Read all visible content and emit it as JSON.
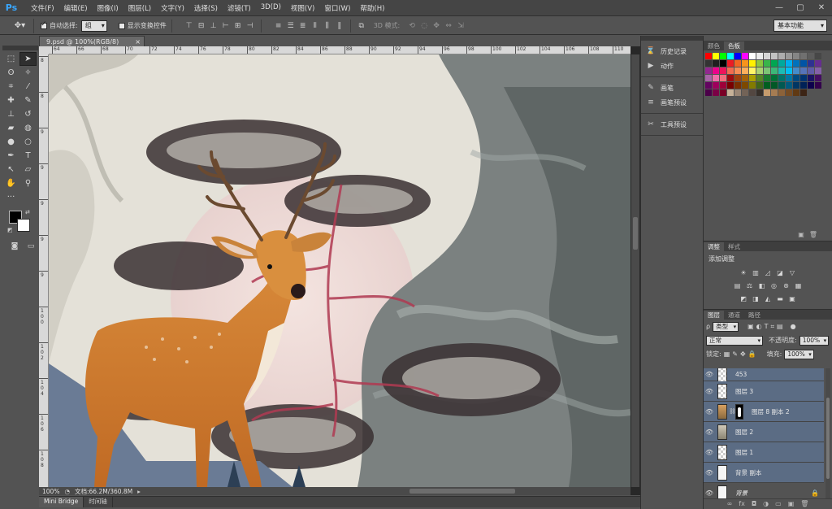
{
  "app": {
    "logo": "Ps",
    "menu": [
      "文件(F)",
      "编辑(E)",
      "图像(I)",
      "图层(L)",
      "文字(Y)",
      "选择(S)",
      "滤镜(T)",
      "3D(D)",
      "视图(V)",
      "窗口(W)",
      "帮助(H)"
    ],
    "window_controls": [
      "—",
      "▢",
      "✕"
    ]
  },
  "options": {
    "auto_select_label": "自动选择:",
    "auto_select_value": "组",
    "show_transform_label": "显示变换控件",
    "mode_3d_label": "3D 模式:",
    "workspace": "基本功能"
  },
  "document": {
    "tab_title": "9.psd @ 100%(RGB/8)",
    "close": "×",
    "zoom": "100%",
    "doc_info": "文档:66.2M/360.8M",
    "ruler_h_labels": [
      "64",
      "66",
      "68",
      "70",
      "72",
      "74",
      "76",
      "78",
      "80",
      "82",
      "84",
      "86",
      "88",
      "90",
      "92",
      "94",
      "96",
      "98",
      "100",
      "102",
      "104",
      "106",
      "108",
      "110"
    ],
    "ruler_v_labels": [
      "8",
      "8",
      "9",
      "9",
      "9",
      "9",
      "9",
      "1 0 0",
      "1 0 2",
      "1 0 4",
      "1 0 6",
      "1 0 8"
    ]
  },
  "bottom_tabs": [
    "Mini Bridge",
    "时间轴"
  ],
  "mid_panel": {
    "groups": [
      [
        {
          "icon": "history-icon",
          "glyph": "⌛",
          "label": "历史记录"
        },
        {
          "icon": "actions-icon",
          "glyph": "▶",
          "label": "动作"
        }
      ],
      [
        {
          "icon": "brush-icon",
          "glyph": "✎",
          "label": "画笔"
        },
        {
          "icon": "brush-presets-icon",
          "glyph": "≡",
          "label": "画笔预设"
        }
      ],
      [
        {
          "icon": "tool-presets-icon",
          "glyph": "✂",
          "label": "工具预设"
        }
      ]
    ]
  },
  "swatches_panel": {
    "tabs": [
      "颜色",
      "色板"
    ],
    "active_tab": 1,
    "colors": [
      "#ff0000",
      "#ffff00",
      "#00ff00",
      "#00ffff",
      "#0000ff",
      "#ff00ff",
      "#ffffff",
      "#ebebeb",
      "#d6d6d6",
      "#c2c2c2",
      "#adadad",
      "#999999",
      "#858585",
      "#707070",
      "#5c5c5c",
      "#474747",
      "#333333",
      "#1f1f1f",
      "#000000",
      "#ed1c24",
      "#f26522",
      "#f7941d",
      "#fff200",
      "#8dc63f",
      "#39b54a",
      "#00a651",
      "#00a99d",
      "#00aeef",
      "#0072bc",
      "#0054a6",
      "#2e3192",
      "#662d91",
      "#92278f",
      "#ec008c",
      "#ed145b",
      "#f26c4f",
      "#f68e56",
      "#fbaf5d",
      "#fff568",
      "#acd373",
      "#7cc576",
      "#3cb878",
      "#1cbbb4",
      "#00bff3",
      "#448ccb",
      "#5674b9",
      "#605ca8",
      "#8560a8",
      "#a864a8",
      "#f06eaa",
      "#f26d7d",
      "#9e0b0f",
      "#a0410d",
      "#a3620a",
      "#aba000",
      "#598527",
      "#1a7b30",
      "#007236",
      "#00746b",
      "#0076a3",
      "#004a80",
      "#003471",
      "#1b1464",
      "#440e62",
      "#630460",
      "#9e005d",
      "#9e0039",
      "#790000",
      "#7b2e00",
      "#7d4900",
      "#827b00",
      "#406618",
      "#005e20",
      "#005826",
      "#005952",
      "#005b7f",
      "#003663",
      "#002157",
      "#0d004c",
      "#32004b",
      "#4b0049",
      "#7b0046",
      "#7a0026",
      "#c7b299",
      "#998675",
      "#736357",
      "#534741",
      "#37302a",
      "#c69c6d",
      "#a67c52",
      "#8c6239",
      "#754c24",
      "#603913",
      "#3c2415"
    ]
  },
  "adjustments_panel": {
    "tabs": [
      "调整",
      "样式"
    ],
    "active_tab": 0,
    "title": "添加调整",
    "row1": [
      {
        "name": "brightness-icon",
        "glyph": "☀"
      },
      {
        "name": "levels-icon",
        "glyph": "▥"
      },
      {
        "name": "curves-icon",
        "glyph": "◿"
      },
      {
        "name": "exposure-icon",
        "glyph": "◪"
      },
      {
        "name": "vibrance-icon",
        "glyph": "▽"
      }
    ],
    "row2": [
      {
        "name": "hue-sat-icon",
        "glyph": "▤"
      },
      {
        "name": "color-balance-icon",
        "glyph": "⚖"
      },
      {
        "name": "bw-icon",
        "glyph": "◧"
      },
      {
        "name": "photo-filter-icon",
        "glyph": "◎"
      },
      {
        "name": "channel-mixer-icon",
        "glyph": "⊛"
      },
      {
        "name": "color-lookup-icon",
        "glyph": "▦"
      }
    ],
    "row3": [
      {
        "name": "invert-icon",
        "glyph": "◩"
      },
      {
        "name": "posterize-icon",
        "glyph": "◨"
      },
      {
        "name": "threshold-icon",
        "glyph": "◭"
      },
      {
        "name": "gradient-map-icon",
        "glyph": "▬"
      },
      {
        "name": "selective-color-icon",
        "glyph": "▣"
      }
    ]
  },
  "layers_panel": {
    "tabs": [
      "图层",
      "通道",
      "路径"
    ],
    "active_tab": 0,
    "filter_kind": "类型",
    "blend_mode": "正常",
    "opacity_label": "不透明度:",
    "opacity_value": "100%",
    "lock_label": "锁定:",
    "fill_label": "填充:",
    "fill_value": "100%",
    "layers": [
      {
        "name": "453",
        "thumb": "checker",
        "selected": true,
        "italic": false
      },
      {
        "name": "图层 3",
        "thumb": "checker",
        "selected": true,
        "italic": false
      },
      {
        "name": "图层 8 副本 2",
        "thumb": "deer",
        "selected": true,
        "italic": false,
        "mask": true
      },
      {
        "name": "图层 2",
        "thumb": "img",
        "selected": true,
        "italic": false
      },
      {
        "name": "图层 1",
        "thumb": "checker",
        "selected": true,
        "italic": false
      },
      {
        "name": "背景 副本",
        "thumb": "plain",
        "selected": true,
        "italic": false
      },
      {
        "name": "背景",
        "thumb": "plain",
        "selected": false,
        "italic": true,
        "locked": true
      }
    ]
  }
}
